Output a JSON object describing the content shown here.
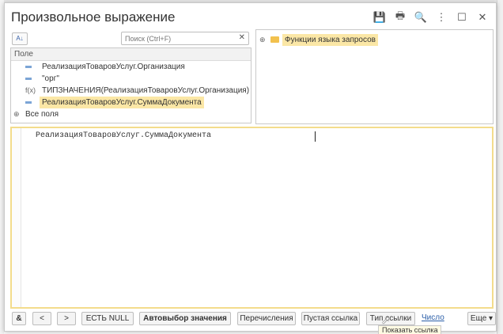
{
  "dialog": {
    "title": "Произвольное выражение",
    "window_buttons": [
      {
        "icon": "save-icon",
        "glyph": "💾"
      },
      {
        "icon": "print-icon",
        "glyph": "🖶"
      },
      {
        "icon": "preview-icon",
        "glyph": "🔍"
      },
      {
        "icon": "more-icon",
        "glyph": "⋮"
      },
      {
        "icon": "maximize-icon",
        "glyph": "☐"
      },
      {
        "icon": "close-icon",
        "glyph": "✕"
      }
    ]
  },
  "fields_panel": {
    "sort_button_label": "A↓",
    "search_placeholder": "Поиск (Ctrl+F)",
    "header": "Поле",
    "items": [
      {
        "label": "РеализацияТоваровУслуг.Организация",
        "icon": "dash",
        "selected": false
      },
      {
        "label": "\"орг\"",
        "icon": "dash",
        "selected": false
      },
      {
        "label": "ТИПЗНАЧЕНИЯ(РеализацияТоваровУслуг.Организация)",
        "icon": "f(x)",
        "selected": false
      },
      {
        "label": "РеализацияТоваровУслуг.СуммаДокумента",
        "icon": "dash",
        "selected": true
      }
    ],
    "all_fields_label": "Все поля"
  },
  "functions_panel": {
    "root_label": "Функции языка запросов"
  },
  "editor": {
    "text": "РеализацияТоваровУслуг.СуммаДокумента"
  },
  "bottom_bar": {
    "amp": "&",
    "prev": "<",
    "next": ">",
    "is_null": "ЕСТЬ NULL",
    "autoselect": "Автовыбор значения",
    "enums": "Перечисления",
    "empty_ref": "Пустая ссылка",
    "ref_type": "Тип ссылки",
    "number_link": "Число",
    "more": "Еще ▾"
  },
  "tooltip": "Показать ссылка"
}
